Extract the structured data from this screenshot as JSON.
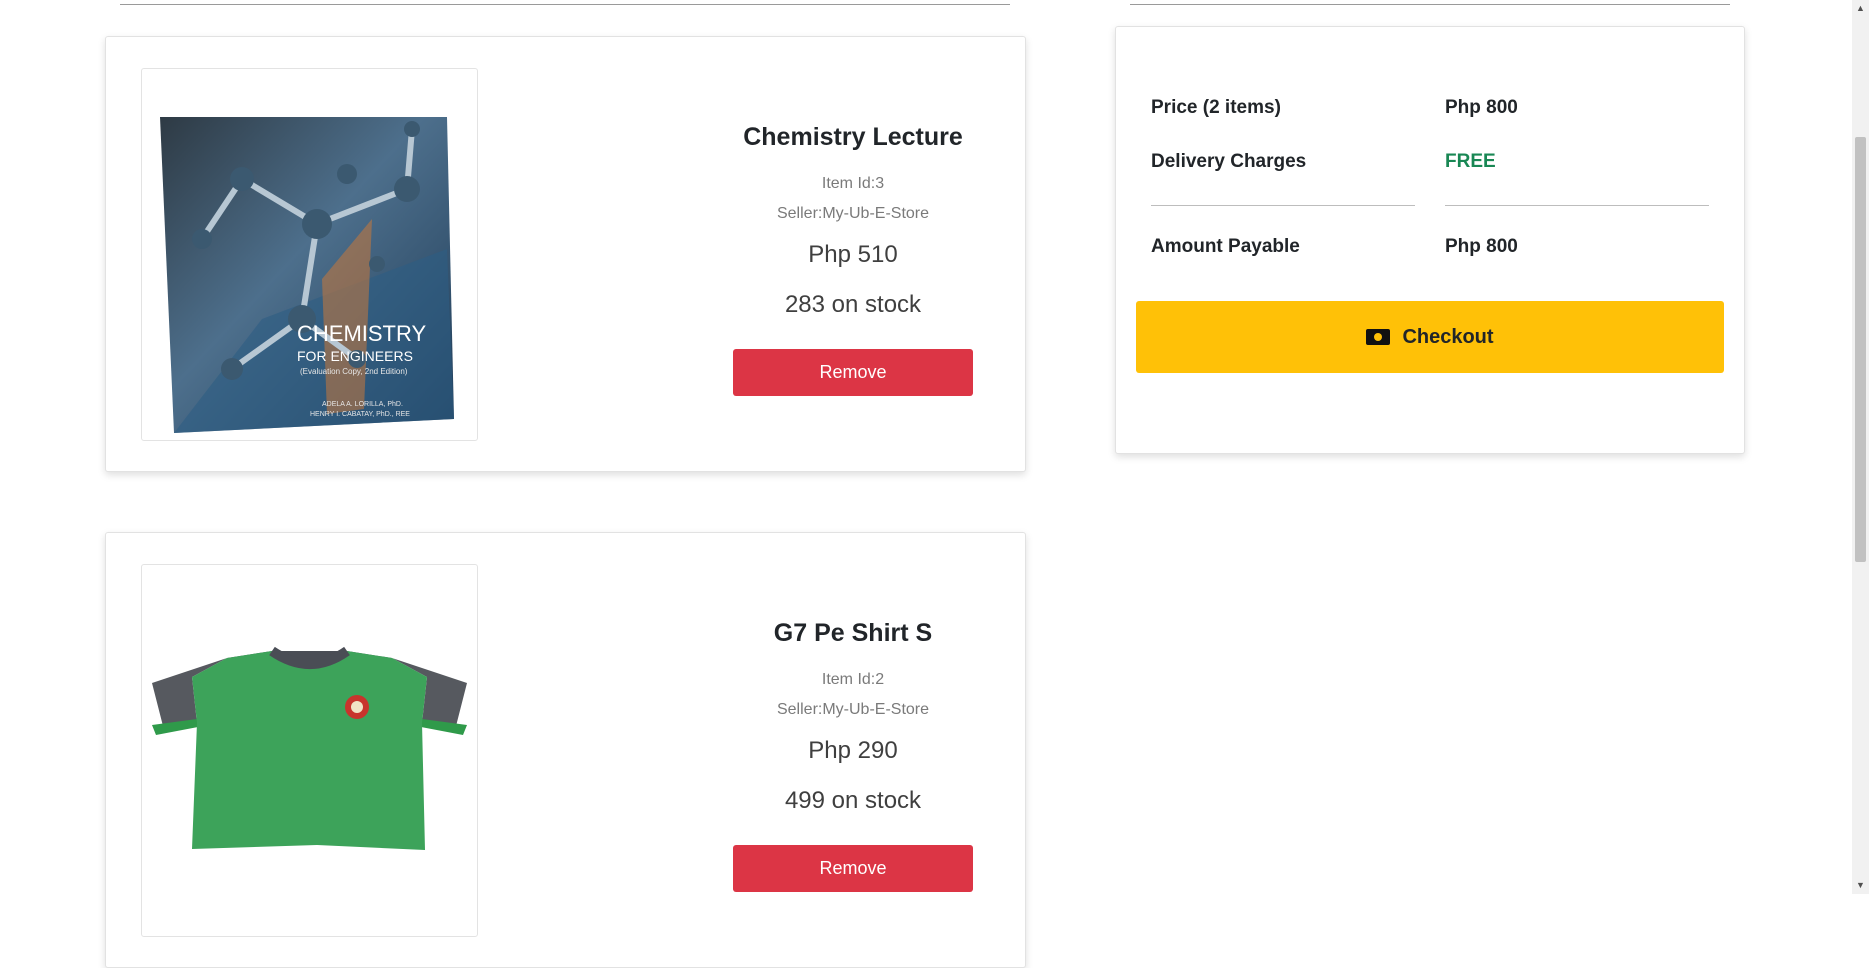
{
  "items": [
    {
      "name": "Chemistry Lecture",
      "item_id": "Item Id:3",
      "seller": "Seller:My-Ub-E-Store",
      "price": "Php 510",
      "stock": "283 on stock",
      "remove_label": "Remove",
      "cover_title": "CHEMISTRY",
      "cover_subtitle": "FOR ENGINEERS",
      "cover_edition": "(Evaluation Copy, 2nd Edition)",
      "cover_author1": "ADELA A. LORILLA, PhD.",
      "cover_author2": "HENRY I. CABATAY, PhD., REE"
    },
    {
      "name": "G7 Pe Shirt S",
      "item_id": "Item Id:2",
      "seller": "Seller:My-Ub-E-Store",
      "price": "Php 290",
      "stock": "499 on stock",
      "remove_label": "Remove"
    }
  ],
  "summary": {
    "price_label": "Price (2 items)",
    "price_value": "Php 800",
    "delivery_label": "Delivery Charges",
    "delivery_value": "FREE",
    "amount_label": "Amount Payable",
    "amount_value": "Php 800",
    "checkout_label": "Checkout"
  },
  "colors": {
    "remove_button": "#dc3545",
    "checkout_button": "#ffc107",
    "free_text": "#198754"
  },
  "icons": [
    "money-bill-icon",
    "scroll-up-arrow-icon",
    "scroll-down-arrow-icon"
  ]
}
